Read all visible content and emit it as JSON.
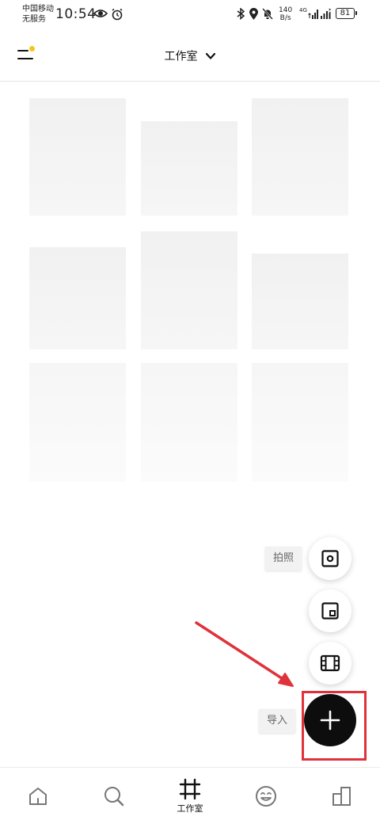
{
  "status_bar": {
    "carrier_line1": "中国移动",
    "carrier_line2": "无服务",
    "time": "10:54",
    "net_speed_value": "140",
    "net_speed_unit": "B/s",
    "signal_label": "4G",
    "battery": "81"
  },
  "app_bar": {
    "title": "工作室",
    "menu_badge_color": "#f5c518"
  },
  "fab_menu": {
    "photo_label": "拍照",
    "import_label": "导入",
    "items": [
      "camera-icon",
      "picture-in-picture-icon",
      "film-icon"
    ],
    "main_icon": "plus-icon"
  },
  "annotation": {
    "highlight_color": "#e0323a"
  },
  "bottom_nav": {
    "items": [
      {
        "icon": "home-icon",
        "label": ""
      },
      {
        "icon": "search-icon",
        "label": ""
      },
      {
        "icon": "crop-icon",
        "label": "工作室"
      },
      {
        "icon": "smiley-icon",
        "label": ""
      },
      {
        "icon": "stats-icon",
        "label": ""
      }
    ],
    "active_index": 2
  }
}
